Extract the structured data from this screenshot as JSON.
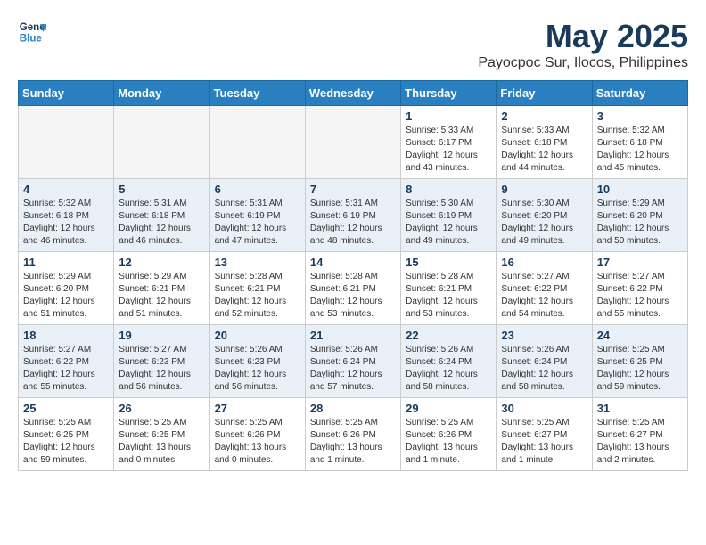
{
  "logo": {
    "line1": "General",
    "line2": "Blue"
  },
  "title": "May 2025",
  "subtitle": "Payocpoc Sur, Ilocos, Philippines",
  "headers": [
    "Sunday",
    "Monday",
    "Tuesday",
    "Wednesday",
    "Thursday",
    "Friday",
    "Saturday"
  ],
  "weeks": [
    [
      {
        "day": "",
        "detail": ""
      },
      {
        "day": "",
        "detail": ""
      },
      {
        "day": "",
        "detail": ""
      },
      {
        "day": "",
        "detail": ""
      },
      {
        "day": "1",
        "detail": "Sunrise: 5:33 AM\nSunset: 6:17 PM\nDaylight: 12 hours\nand 43 minutes."
      },
      {
        "day": "2",
        "detail": "Sunrise: 5:33 AM\nSunset: 6:18 PM\nDaylight: 12 hours\nand 44 minutes."
      },
      {
        "day": "3",
        "detail": "Sunrise: 5:32 AM\nSunset: 6:18 PM\nDaylight: 12 hours\nand 45 minutes."
      }
    ],
    [
      {
        "day": "4",
        "detail": "Sunrise: 5:32 AM\nSunset: 6:18 PM\nDaylight: 12 hours\nand 46 minutes."
      },
      {
        "day": "5",
        "detail": "Sunrise: 5:31 AM\nSunset: 6:18 PM\nDaylight: 12 hours\nand 46 minutes."
      },
      {
        "day": "6",
        "detail": "Sunrise: 5:31 AM\nSunset: 6:19 PM\nDaylight: 12 hours\nand 47 minutes."
      },
      {
        "day": "7",
        "detail": "Sunrise: 5:31 AM\nSunset: 6:19 PM\nDaylight: 12 hours\nand 48 minutes."
      },
      {
        "day": "8",
        "detail": "Sunrise: 5:30 AM\nSunset: 6:19 PM\nDaylight: 12 hours\nand 49 minutes."
      },
      {
        "day": "9",
        "detail": "Sunrise: 5:30 AM\nSunset: 6:20 PM\nDaylight: 12 hours\nand 49 minutes."
      },
      {
        "day": "10",
        "detail": "Sunrise: 5:29 AM\nSunset: 6:20 PM\nDaylight: 12 hours\nand 50 minutes."
      }
    ],
    [
      {
        "day": "11",
        "detail": "Sunrise: 5:29 AM\nSunset: 6:20 PM\nDaylight: 12 hours\nand 51 minutes."
      },
      {
        "day": "12",
        "detail": "Sunrise: 5:29 AM\nSunset: 6:21 PM\nDaylight: 12 hours\nand 51 minutes."
      },
      {
        "day": "13",
        "detail": "Sunrise: 5:28 AM\nSunset: 6:21 PM\nDaylight: 12 hours\nand 52 minutes."
      },
      {
        "day": "14",
        "detail": "Sunrise: 5:28 AM\nSunset: 6:21 PM\nDaylight: 12 hours\nand 53 minutes."
      },
      {
        "day": "15",
        "detail": "Sunrise: 5:28 AM\nSunset: 6:21 PM\nDaylight: 12 hours\nand 53 minutes."
      },
      {
        "day": "16",
        "detail": "Sunrise: 5:27 AM\nSunset: 6:22 PM\nDaylight: 12 hours\nand 54 minutes."
      },
      {
        "day": "17",
        "detail": "Sunrise: 5:27 AM\nSunset: 6:22 PM\nDaylight: 12 hours\nand 55 minutes."
      }
    ],
    [
      {
        "day": "18",
        "detail": "Sunrise: 5:27 AM\nSunset: 6:22 PM\nDaylight: 12 hours\nand 55 minutes."
      },
      {
        "day": "19",
        "detail": "Sunrise: 5:27 AM\nSunset: 6:23 PM\nDaylight: 12 hours\nand 56 minutes."
      },
      {
        "day": "20",
        "detail": "Sunrise: 5:26 AM\nSunset: 6:23 PM\nDaylight: 12 hours\nand 56 minutes."
      },
      {
        "day": "21",
        "detail": "Sunrise: 5:26 AM\nSunset: 6:24 PM\nDaylight: 12 hours\nand 57 minutes."
      },
      {
        "day": "22",
        "detail": "Sunrise: 5:26 AM\nSunset: 6:24 PM\nDaylight: 12 hours\nand 58 minutes."
      },
      {
        "day": "23",
        "detail": "Sunrise: 5:26 AM\nSunset: 6:24 PM\nDaylight: 12 hours\nand 58 minutes."
      },
      {
        "day": "24",
        "detail": "Sunrise: 5:25 AM\nSunset: 6:25 PM\nDaylight: 12 hours\nand 59 minutes."
      }
    ],
    [
      {
        "day": "25",
        "detail": "Sunrise: 5:25 AM\nSunset: 6:25 PM\nDaylight: 12 hours\nand 59 minutes."
      },
      {
        "day": "26",
        "detail": "Sunrise: 5:25 AM\nSunset: 6:25 PM\nDaylight: 13 hours\nand 0 minutes."
      },
      {
        "day": "27",
        "detail": "Sunrise: 5:25 AM\nSunset: 6:26 PM\nDaylight: 13 hours\nand 0 minutes."
      },
      {
        "day": "28",
        "detail": "Sunrise: 5:25 AM\nSunset: 6:26 PM\nDaylight: 13 hours\nand 1 minute."
      },
      {
        "day": "29",
        "detail": "Sunrise: 5:25 AM\nSunset: 6:26 PM\nDaylight: 13 hours\nand 1 minute."
      },
      {
        "day": "30",
        "detail": "Sunrise: 5:25 AM\nSunset: 6:27 PM\nDaylight: 13 hours\nand 1 minute."
      },
      {
        "day": "31",
        "detail": "Sunrise: 5:25 AM\nSunset: 6:27 PM\nDaylight: 13 hours\nand 2 minutes."
      }
    ]
  ]
}
